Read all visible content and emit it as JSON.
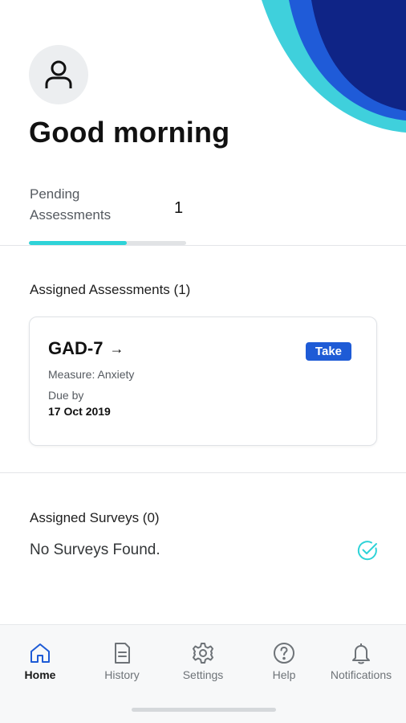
{
  "header": {
    "greeting": "Good morning"
  },
  "stats": {
    "pending_label": "Pending Assessments",
    "pending_count": "1",
    "pending_progress": 0.62
  },
  "assessments": {
    "section_title": "Assigned Assessments (1)",
    "items": [
      {
        "title": "GAD-7",
        "arrow": "→",
        "action_label": "Take",
        "measure": "Measure: Anxiety",
        "due_label": "Due by",
        "due_date": "17 Oct 2019"
      }
    ]
  },
  "surveys": {
    "section_title": "Assigned Surveys (0)",
    "empty_text": "No Surveys Found."
  },
  "nav": {
    "items": [
      {
        "label": "Home",
        "icon": "home-icon",
        "active": true
      },
      {
        "label": "History",
        "icon": "document-icon",
        "active": false
      },
      {
        "label": "Settings",
        "icon": "gear-icon",
        "active": false
      },
      {
        "label": "Help",
        "icon": "help-icon",
        "active": false
      },
      {
        "label": "Notifications",
        "icon": "bell-icon",
        "active": false
      }
    ]
  },
  "colors": {
    "accent_teal": "#2ed3d8",
    "primary_blue": "#1e5bd6",
    "decor_navy": "#0f2486",
    "decor_blue": "#1f5bd8",
    "decor_teal": "#3fd0dc"
  }
}
